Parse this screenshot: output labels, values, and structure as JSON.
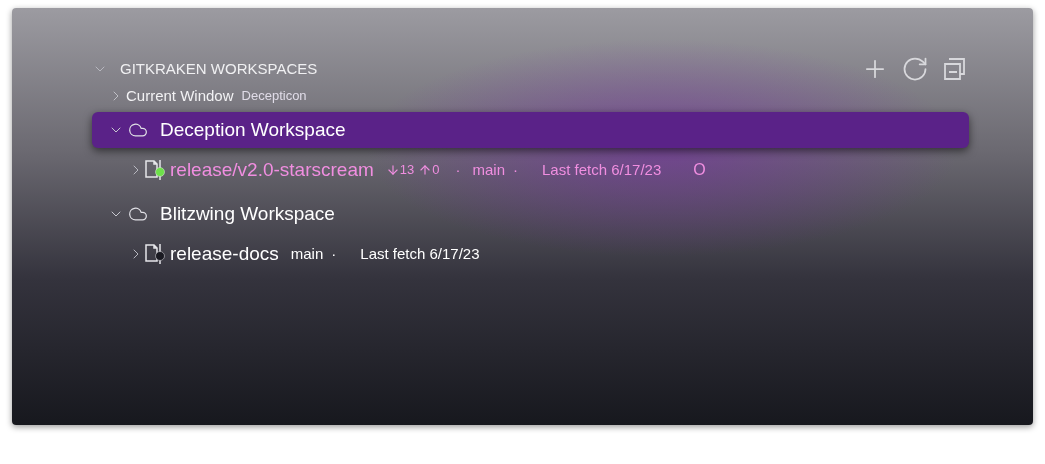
{
  "section": {
    "title": "GITKRAKEN WORKSPACES",
    "expanded": true
  },
  "current_window": {
    "label": "Current Window",
    "value": "Decepticon",
    "expanded": false
  },
  "workspaces": [
    {
      "name": "Deception Workspace",
      "expanded": true,
      "selected": true,
      "repos": [
        {
          "name": "release/v2.0-starscream",
          "expanded": false,
          "active": true,
          "color": "#6ee04a",
          "behind": "13",
          "ahead": "0",
          "sep1": "·",
          "branch": "main",
          "sep2": "·",
          "fetch": "Last fetch 6/17/23",
          "status": "O"
        }
      ]
    },
    {
      "name": "Blitzwing Workspace",
      "expanded": true,
      "selected": false,
      "repos": [
        {
          "name": "release-docs",
          "expanded": false,
          "active": false,
          "color": "#1a1a22",
          "branch": "main",
          "sep2": "·",
          "fetch": "Last fetch 6/17/23"
        }
      ]
    }
  ]
}
